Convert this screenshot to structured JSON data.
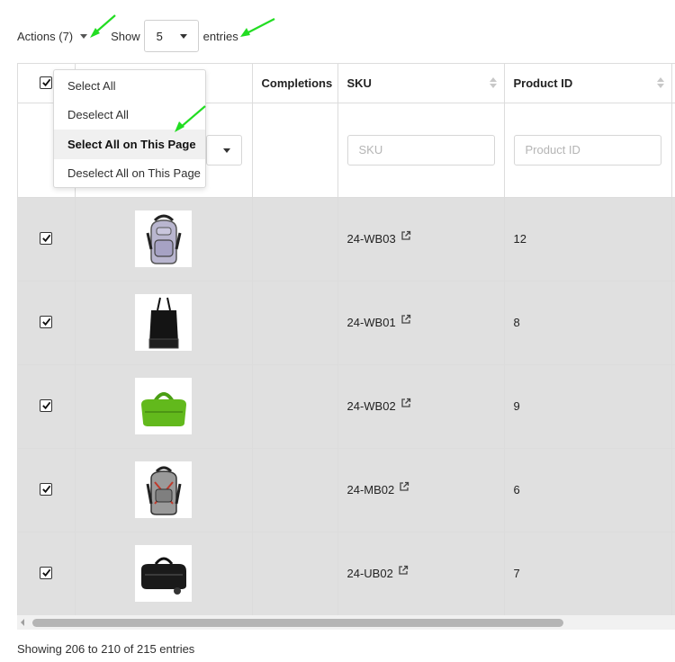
{
  "toolbar": {
    "actions_label": "Actions (7)",
    "show_label": "Show",
    "per_page_value": "5",
    "entries_label": "entries"
  },
  "columns": {
    "completions": "Completions",
    "sku": "SKU",
    "product_id": "Product ID"
  },
  "filters": {
    "sku_placeholder": "SKU",
    "product_id_placeholder": "Product ID"
  },
  "dropdown": {
    "items": [
      {
        "label": "Select All"
      },
      {
        "label": "Deselect All"
      },
      {
        "label": "Select All on This Page"
      },
      {
        "label": "Deselect All on This Page"
      }
    ],
    "active_index": 2
  },
  "rows": [
    {
      "sku": "24-WB03",
      "product_id": "12",
      "thumbnail": "purple-backpack-image",
      "checked": true
    },
    {
      "sku": "24-WB01",
      "product_id": "8",
      "thumbnail": "black-tote-bag-image",
      "checked": true
    },
    {
      "sku": "24-WB02",
      "product_id": "9",
      "thumbnail": "green-duffel-bag-image",
      "checked": true
    },
    {
      "sku": "24-MB02",
      "product_id": "6",
      "thumbnail": "gray-red-backpack-image",
      "checked": true
    },
    {
      "sku": "24-UB02",
      "product_id": "7",
      "thumbnail": "black-rolling-duffel-image",
      "checked": true
    }
  ],
  "footer": {
    "info": "Showing 206 to 210 of 215 entries"
  },
  "colors": {
    "selected_row_bg": "#e0e0e0",
    "annotation_arrow": "#22dd22"
  }
}
